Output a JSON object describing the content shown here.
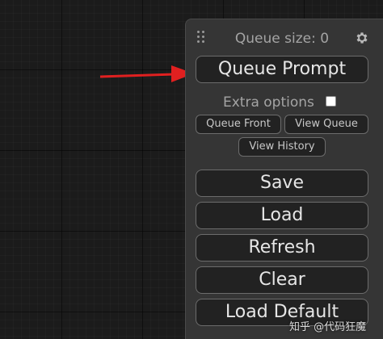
{
  "panel": {
    "queue_size_label": "Queue size: 0",
    "queue_prompt_label": "Queue Prompt",
    "extra_options_label": "Extra options",
    "extra_options_checked": false,
    "queue_front_label": "Queue Front",
    "view_queue_label": "View Queue",
    "view_history_label": "View History",
    "save_label": "Save",
    "load_label": "Load",
    "refresh_label": "Refresh",
    "clear_label": "Clear",
    "load_default_label": "Load Default"
  },
  "annotation": {
    "arrow_color": "#e02020"
  },
  "watermark": {
    "text": "知乎 @代码狂魔"
  },
  "colors": {
    "canvas_bg": "#1b1b1b",
    "panel_bg": "#353535",
    "button_bg": "#222222",
    "button_text": "#e6e6e6"
  }
}
